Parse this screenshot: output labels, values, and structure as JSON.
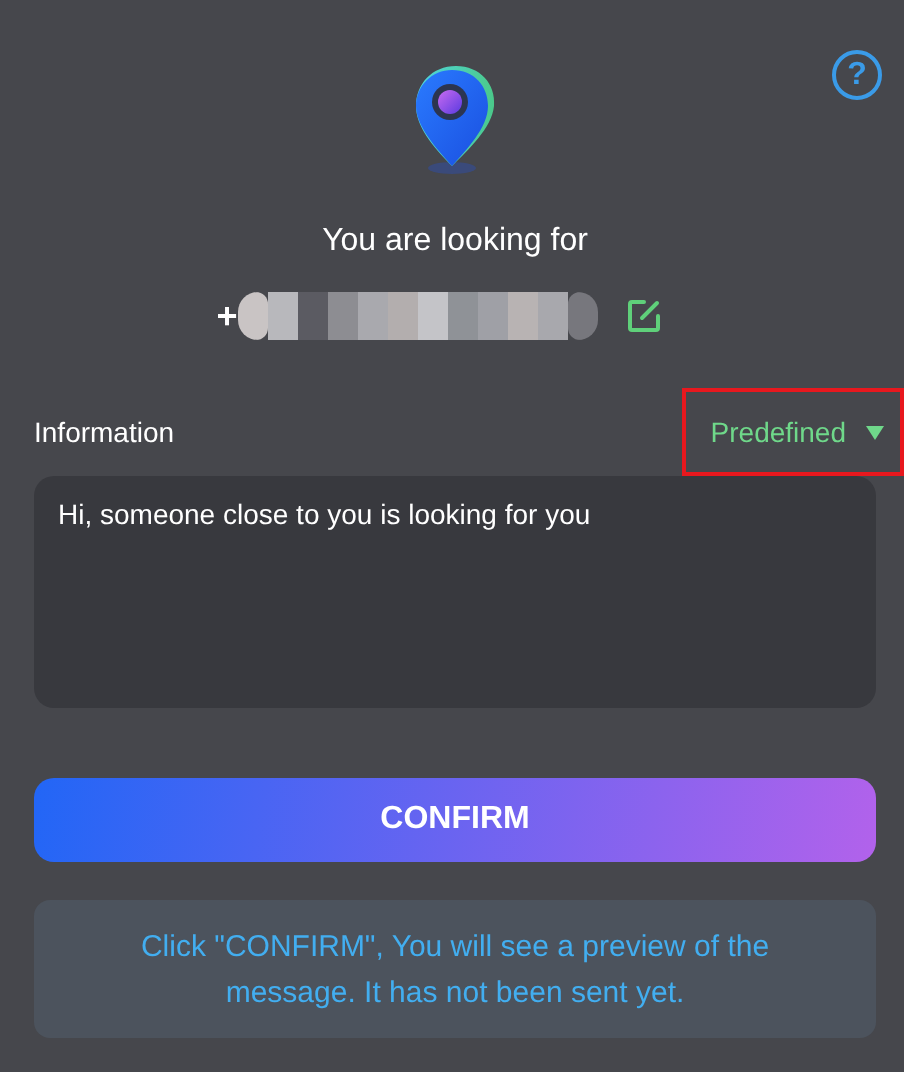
{
  "help": "?",
  "title": "You are looking for",
  "phone": {
    "prefix": "+",
    "redacted": true
  },
  "information": {
    "label": "Information",
    "selector": {
      "value": "Predefined",
      "highlighted": true
    },
    "message": "Hi, someone close to you is looking for you"
  },
  "confirm_button": "CONFIRM",
  "note": "Click \"CONFIRM\", You will see a preview of the message. It has not been sent yet."
}
